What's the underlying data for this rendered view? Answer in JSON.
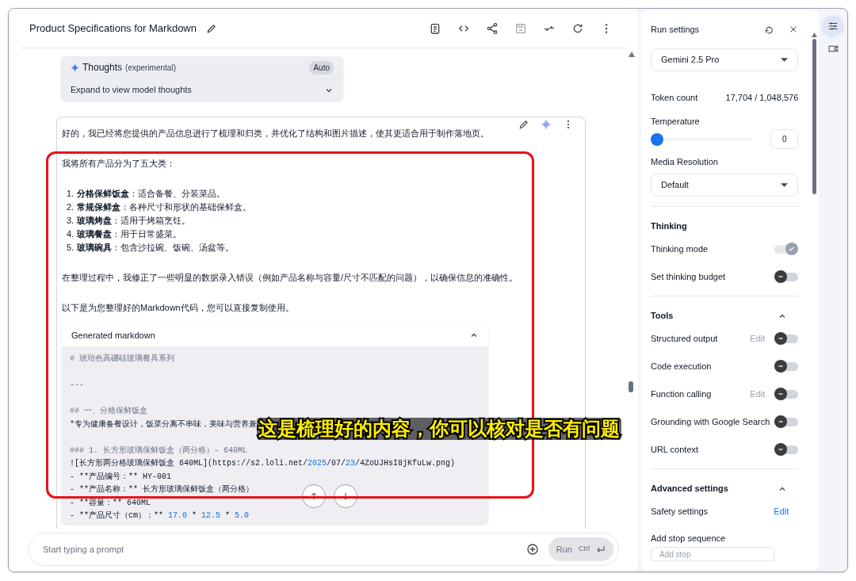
{
  "header": {
    "title": "Product Specifications for Markdown"
  },
  "thoughts": {
    "title": "Thoughts",
    "tag": "(experimental)",
    "badge": "Auto",
    "expand_label": "Expand to view model thoughts",
    "expanded": false
  },
  "response": {
    "intro": "好的，我已经将您提供的产品信息进行了梳理和归类，并优化了结构和图片描述，使其更适合用于制作落地页。",
    "lead": "我将所有产品分为了五大类：",
    "categories": [
      {
        "number": "1.",
        "text": "**分格保鲜饭盒**：适合备餐、分装菜品。"
      },
      {
        "number": "2.",
        "text": "**常规保鲜盒**：各种尺寸和形状的基础保鲜盒。"
      },
      {
        "number": "3.",
        "text": "**玻璃烤盘**：适用于烤箱烹饪。"
      },
      {
        "number": "4.",
        "text": "**玻璃餐盘**：用于日常盛菜。"
      },
      {
        "number": "5.",
        "text": "**玻璃碗具**：包含沙拉碗、饭碗、汤盆等。"
      }
    ],
    "note": "在整理过程中，我修正了一些明显的数据录入错误（例如产品名称与容量/尺寸不匹配的问题），以确保信息的准确性。",
    "outro": "以下是为您整理好的Markdown代码，您可以直接复制使用。",
    "code_block": {
      "title": "Generated markdown",
      "expanded": true,
      "lines": [
        {
          "spaced": false,
          "tokens": [
            {
              "kind": "heading",
              "text": "# 琥珀色高硼硅玻璃餐具系列"
            }
          ]
        },
        {
          "spaced": true,
          "tokens": [
            {
              "kind": "heading",
              "text": "---"
            }
          ]
        },
        {
          "spaced": true,
          "tokens": [
            {
              "kind": "heading",
              "text": "## 一、分格保鲜饭盒"
            }
          ]
        },
        {
          "spaced": false,
          "tokens": [
            {
              "kind": "plain",
              "text": "*专为健康备餐设计，饭菜分离不串味，美味与营养兼"
            }
          ]
        },
        {
          "spaced": true,
          "tokens": [
            {
              "kind": "heading",
              "text": "### 1. 长方形玻璃保鲜饭盒（两分格）- 640ML"
            }
          ]
        },
        {
          "spaced": false,
          "tokens": [
            {
              "kind": "plain",
              "text": "![长方形两分格玻璃保鲜饭盒 640ML](https://s2.loli.net/"
            },
            {
              "kind": "number",
              "text": "2025"
            },
            {
              "kind": "plain",
              "text": "/07/"
            },
            {
              "kind": "number",
              "text": "23"
            },
            {
              "kind": "plain",
              "text": "/4ZoUJHsI8jKfuLw.png)"
            }
          ]
        },
        {
          "spaced": false,
          "tokens": [
            {
              "kind": "plain",
              "text": "- **产品编号：** HY-001"
            }
          ]
        },
        {
          "spaced": false,
          "tokens": [
            {
              "kind": "plain",
              "text": "- **产品名称：** 长方形玻璃保鲜饭盒（两分格）"
            }
          ]
        },
        {
          "spaced": false,
          "tokens": [
            {
              "kind": "plain",
              "text": "- **容量：** 640ML"
            }
          ]
        },
        {
          "spaced": false,
          "tokens": [
            {
              "kind": "plain",
              "text": "- **产品尺寸（cm）：** "
            },
            {
              "kind": "number",
              "text": "17.0"
            },
            {
              "kind": "plain",
              "text": " * "
            },
            {
              "kind": "number",
              "text": "12.5"
            },
            {
              "kind": "plain",
              "text": " * "
            },
            {
              "kind": "number",
              "text": "5.0"
            }
          ]
        }
      ]
    }
  },
  "prompt": {
    "placeholder": "Start typing a prompt",
    "run_label": "Run",
    "shortcut": "Ctrl"
  },
  "settings": {
    "title": "Run settings",
    "model": "Gemini 2.5 Pro",
    "token_label": "Token count",
    "token_value": "17,704 / 1,048,576",
    "temperature": {
      "label": "Temperature",
      "level": 0,
      "value": "0"
    },
    "media": {
      "label": "Media Resolution",
      "value": "Default"
    },
    "sections": [
      {
        "title": "Thinking",
        "rows": [
          {
            "kind": "toggle",
            "label": "Thinking mode",
            "on": true,
            "disabled": true
          },
          {
            "kind": "toggle",
            "label": "Set thinking budget",
            "on": false,
            "disabled": false
          }
        ]
      },
      {
        "title": "Tools",
        "expanded": true,
        "rows": [
          {
            "kind": "toggle",
            "label": "Structured output",
            "edit": "Edit",
            "on": false,
            "disabled": false
          },
          {
            "kind": "toggle",
            "label": "Code execution",
            "on": false,
            "disabled": false
          },
          {
            "kind": "toggle",
            "label": "Function calling",
            "edit": "Edit",
            "on": false,
            "disabled": false
          },
          {
            "kind": "toggle",
            "label": "Grounding with Google Search",
            "on": false,
            "disabled": false
          },
          {
            "kind": "toggle",
            "label": "URL context",
            "on": false,
            "disabled": false
          }
        ]
      },
      {
        "title": "Advanced settings",
        "expanded": true,
        "rows": [
          {
            "kind": "link",
            "label": "Safety settings",
            "action": "Edit"
          },
          {
            "kind": "field",
            "label": "Add stop sequence",
            "placeholder": "Add stop"
          }
        ]
      }
    ]
  },
  "caption": "这是梳理好的内容，你可以核对是否有问题"
}
